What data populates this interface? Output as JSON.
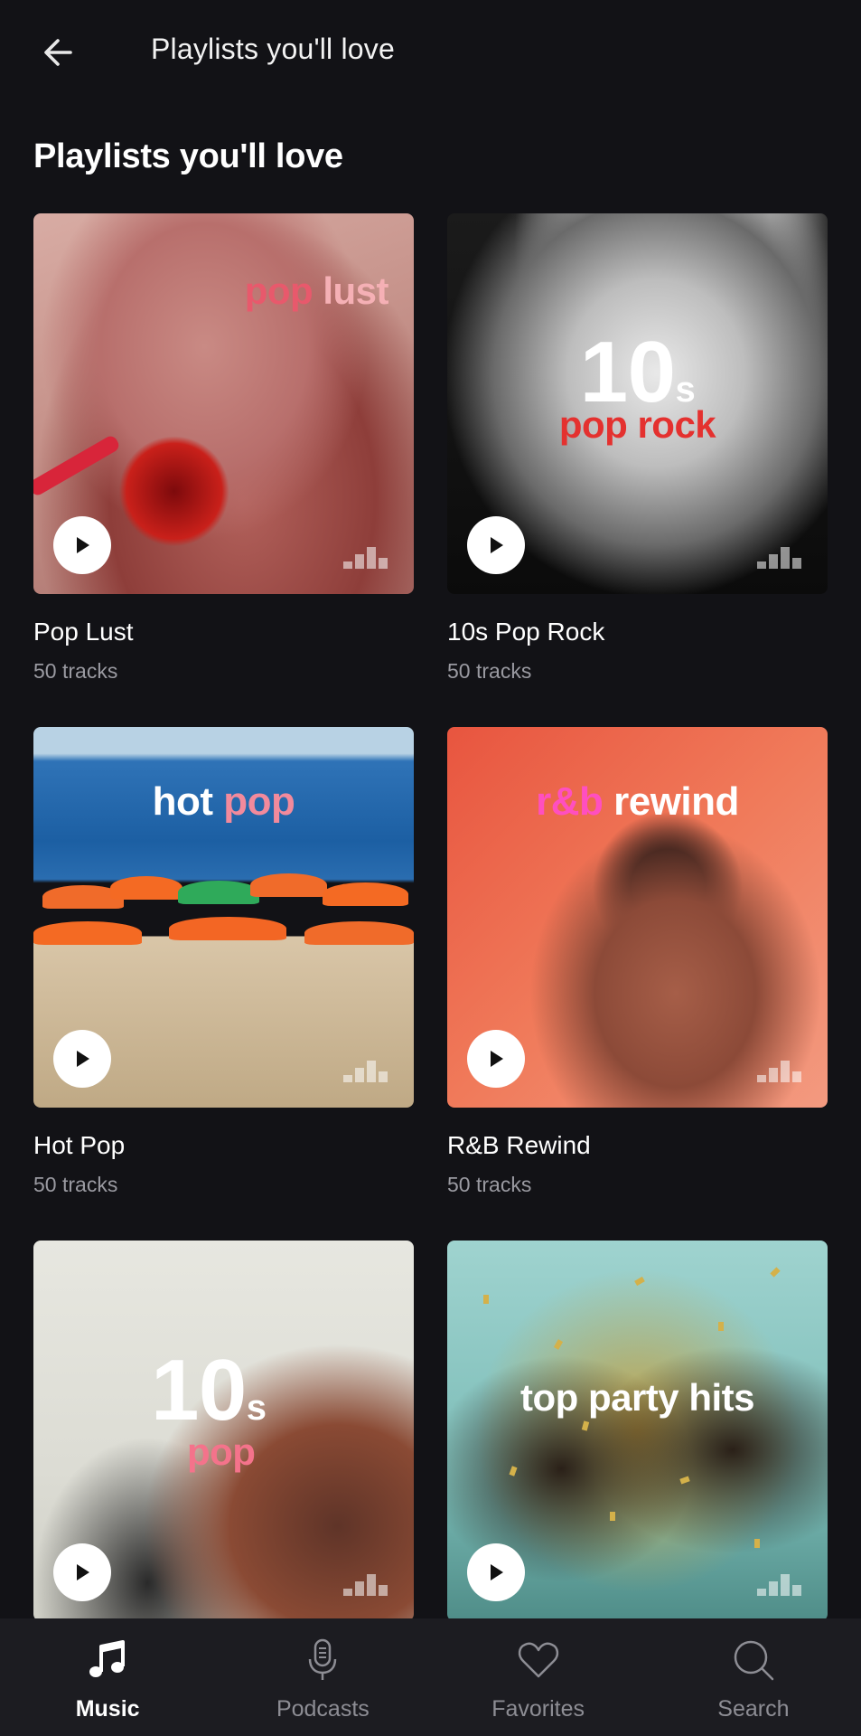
{
  "header": {
    "title": "Playlists you'll love",
    "back_icon": "arrow-left-icon"
  },
  "section": {
    "title": "Playlists you'll love"
  },
  "playlists": [
    {
      "title": "Pop Lust",
      "tracks": "50 tracks",
      "cover_words": [
        "pop",
        "lust"
      ],
      "cover_colors": [
        "#e8596c",
        "#f5b0b5"
      ]
    },
    {
      "title": "10s Pop Rock",
      "tracks": "50 tracks",
      "cover_words": [
        "10",
        "s",
        "pop rock"
      ],
      "cover_colors": [
        "#ffffff",
        "#ffffff",
        "#e4312f"
      ]
    },
    {
      "title": "Hot Pop",
      "tracks": "50 tracks",
      "cover_words": [
        "hot",
        "pop"
      ],
      "cover_colors": [
        "#ffffff",
        "#f28a9c"
      ]
    },
    {
      "title": "R&B Rewind",
      "tracks": "50 tracks",
      "cover_words": [
        "r&b",
        "rewind"
      ],
      "cover_colors": [
        "#ff4fc0",
        "#ffffff"
      ]
    },
    {
      "title": "",
      "tracks": "",
      "cover_words": [
        "10",
        "s",
        "pop"
      ],
      "cover_colors": [
        "#ffffff",
        "#ffffff",
        "#f4738b"
      ]
    },
    {
      "title": "",
      "tracks": "",
      "cover_words": [
        "top party hits"
      ],
      "cover_colors": [
        "#ffffff"
      ]
    }
  ],
  "nav": {
    "items": [
      {
        "label": "Music",
        "icon": "music-note-icon",
        "active": true
      },
      {
        "label": "Podcasts",
        "icon": "microphone-icon",
        "active": false
      },
      {
        "label": "Favorites",
        "icon": "heart-icon",
        "active": false
      },
      {
        "label": "Search",
        "icon": "search-icon",
        "active": false
      }
    ]
  },
  "colors": {
    "background": "#121216",
    "nav_background": "#1c1c21",
    "secondary_text": "#9a9aa1"
  }
}
